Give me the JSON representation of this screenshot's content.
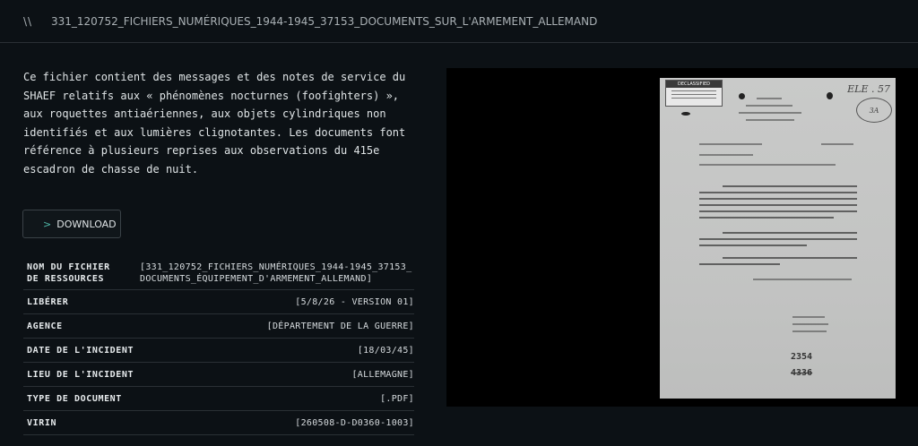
{
  "header": {
    "prefix": "\\\\",
    "title": "331_120752_FICHIERS_NUMÉRIQUES_1944-1945_37153_DOCUMENTS_SUR_L'ARMEMENT_ALLEMAND"
  },
  "description": "Ce fichier contient des messages et des notes de service du SHAEF relatifs aux « phénomènes nocturnes (foofighters) », aux roquettes antiaériennes, aux objets cylindriques non identifiés et aux lumières clignotantes. Les documents font référence à plusieurs reprises aux observations du 415e escadron de chasse de nuit.",
  "download": {
    "icon": "chevron-right-icon",
    "chevron": ">",
    "label": "DOWNLOAD"
  },
  "metadata": [
    {
      "label": "NOM DU FICHIER DE RESSOURCES",
      "value": "[331_120752_FICHIERS_NUMÉRIQUES_1944-1945_37153_DOCUMENTS_ÉQUIPEMENT_D'ARMEMENT_ALLEMAND]"
    },
    {
      "label": "LIBÉRER",
      "value": "[5/8/26 - VERSION 01]"
    },
    {
      "label": "AGENCE",
      "value": "[DÉPARTEMENT DE LA GUERRE]"
    },
    {
      "label": "DATE DE L'INCIDENT",
      "value": "[18/03/45]"
    },
    {
      "label": "LIEU DE L'INCIDENT",
      "value": "[ALLEMAGNE]"
    },
    {
      "label": "TYPE DE DOCUMENT",
      "value": "[.PDF]"
    },
    {
      "label": "VIRIN",
      "value": "[260508-D-D0360-1003]"
    }
  ],
  "document_preview": {
    "stamp_header": "DECLASSIFIED",
    "handwriting": "ELE . 57",
    "circle_stamp": "3A",
    "number_stamp": "2354",
    "number_stamp_struck": "4336"
  },
  "colors": {
    "background": "#0c1115",
    "accent": "#4fb8a8",
    "divider": "#2a3035"
  }
}
